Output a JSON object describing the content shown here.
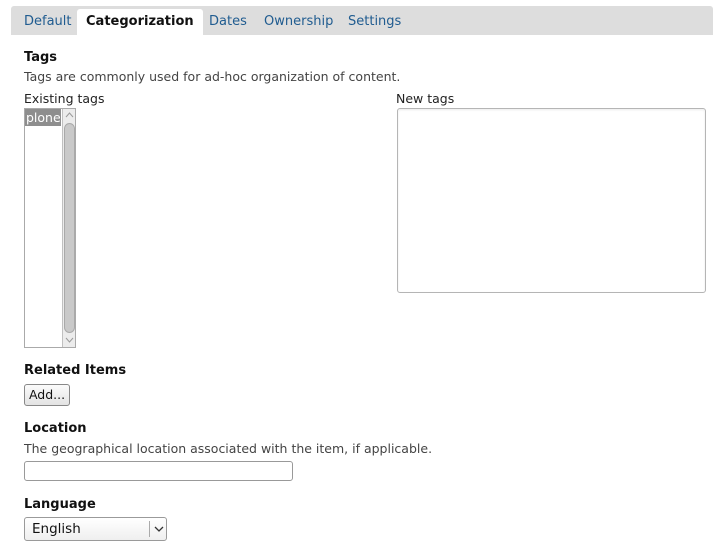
{
  "tabs": [
    {
      "label": "Default"
    },
    {
      "label": "Categorization"
    },
    {
      "label": "Dates"
    },
    {
      "label": "Ownership"
    },
    {
      "label": "Settings"
    }
  ],
  "active_tab": "Categorization",
  "tags": {
    "heading": "Tags",
    "help": "Tags are commonly used for ad-hoc organization of content.",
    "existing_label": "Existing tags",
    "existing_options": [
      "plone"
    ],
    "existing_selected": "plone",
    "new_label": "New tags",
    "new_value": ""
  },
  "related": {
    "heading": "Related Items",
    "add_label": "Add..."
  },
  "location": {
    "heading": "Location",
    "help": "The geographical location associated with the item, if applicable.",
    "value": ""
  },
  "language": {
    "heading": "Language",
    "selected": "English"
  },
  "colors": {
    "tab_link": "#205c90",
    "tab_bar": "#dddddd",
    "selection": "#8e8e8e"
  },
  "icons": {
    "scroll_up": "triangle-up-icon",
    "scroll_down": "triangle-down-icon",
    "select_arrow": "chevron-down-icon"
  }
}
